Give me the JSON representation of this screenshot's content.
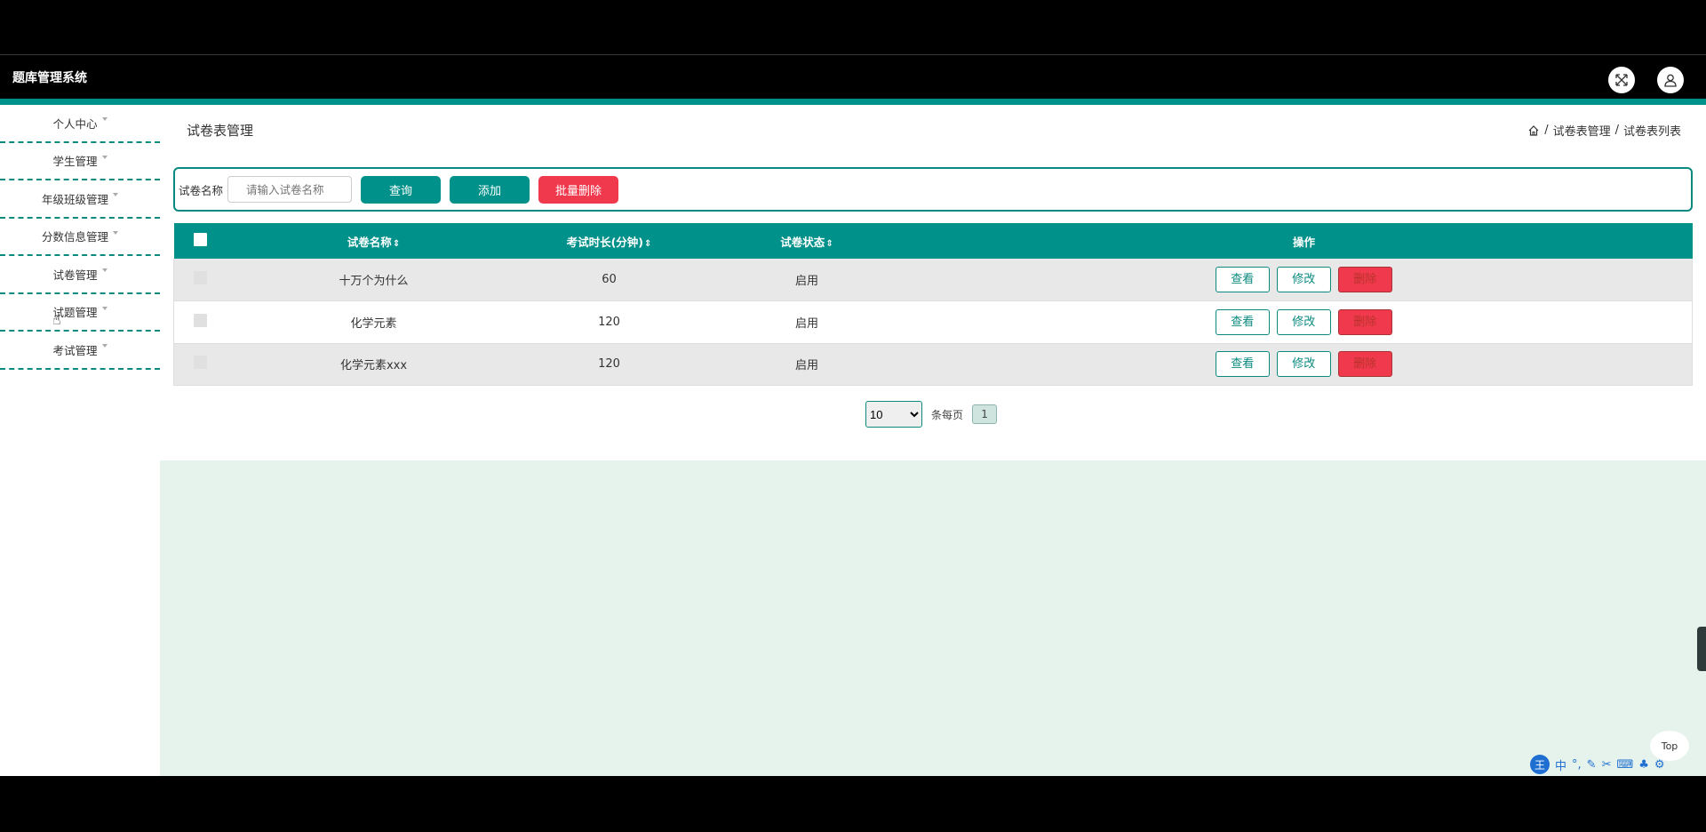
{
  "app": {
    "title": "题库管理系统"
  },
  "sidebar": {
    "items": [
      {
        "label": "个人中心"
      },
      {
        "label": "学生管理"
      },
      {
        "label": "年级班级管理"
      },
      {
        "label": "分数信息管理"
      },
      {
        "label": "试卷管理"
      },
      {
        "label": "试题管理"
      },
      {
        "label": "考试管理"
      }
    ]
  },
  "main": {
    "title": "试卷表管理",
    "breadcrumb": [
      "试卷表管理",
      "试卷表列表"
    ]
  },
  "search": {
    "label": "试卷名称",
    "placeholder": "请输入试卷名称",
    "query_btn": "查询",
    "add_btn": "添加",
    "batch_delete_btn": "批量删除"
  },
  "table": {
    "headers": [
      "试卷名称",
      "考试时长(分钟)",
      "试卷状态",
      "操作"
    ],
    "rows": [
      {
        "name": "十万个为什么",
        "duration": "60",
        "status": "启用"
      },
      {
        "name": "化学元素",
        "duration": "120",
        "status": "启用"
      },
      {
        "name": "化学元素xxx",
        "duration": "120",
        "status": "启用"
      }
    ],
    "actions": {
      "view": "查看",
      "edit": "修改",
      "delete": "删除"
    }
  },
  "pager": {
    "page_size": "10",
    "per_page_label": "条每页",
    "current_page": "1"
  },
  "floating": {
    "top_label": "Top"
  },
  "ime": {
    "icon": "王",
    "mode": "中"
  },
  "colors": {
    "accent": "#00918a",
    "danger": "#f1394e",
    "content_bg": "#e6f3ec"
  }
}
